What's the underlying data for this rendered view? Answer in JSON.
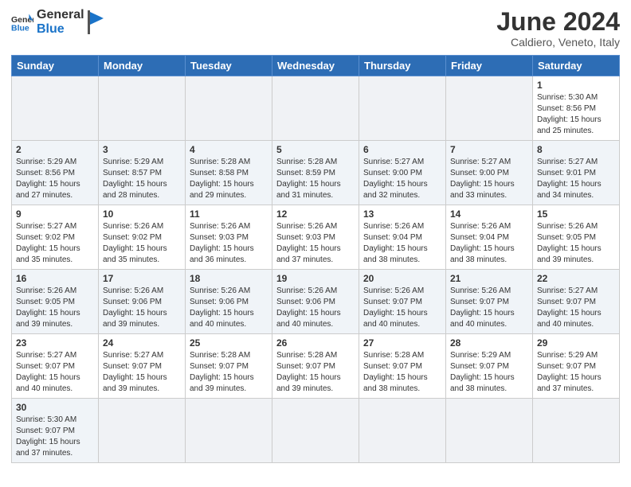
{
  "header": {
    "logo_general": "General",
    "logo_blue": "Blue",
    "title": "June 2024",
    "subtitle": "Caldiero, Veneto, Italy"
  },
  "weekdays": [
    "Sunday",
    "Monday",
    "Tuesday",
    "Wednesday",
    "Thursday",
    "Friday",
    "Saturday"
  ],
  "weeks": [
    [
      {
        "day": "",
        "info": ""
      },
      {
        "day": "",
        "info": ""
      },
      {
        "day": "",
        "info": ""
      },
      {
        "day": "",
        "info": ""
      },
      {
        "day": "",
        "info": ""
      },
      {
        "day": "",
        "info": ""
      },
      {
        "day": "1",
        "info": "Sunrise: 5:30 AM\nSunset: 8:56 PM\nDaylight: 15 hours\nand 25 minutes."
      }
    ],
    [
      {
        "day": "2",
        "info": "Sunrise: 5:29 AM\nSunset: 8:56 PM\nDaylight: 15 hours\nand 27 minutes."
      },
      {
        "day": "3",
        "info": "Sunrise: 5:29 AM\nSunset: 8:57 PM\nDaylight: 15 hours\nand 28 minutes."
      },
      {
        "day": "4",
        "info": "Sunrise: 5:28 AM\nSunset: 8:58 PM\nDaylight: 15 hours\nand 29 minutes."
      },
      {
        "day": "5",
        "info": "Sunrise: 5:28 AM\nSunset: 8:59 PM\nDaylight: 15 hours\nand 31 minutes."
      },
      {
        "day": "6",
        "info": "Sunrise: 5:27 AM\nSunset: 9:00 PM\nDaylight: 15 hours\nand 32 minutes."
      },
      {
        "day": "7",
        "info": "Sunrise: 5:27 AM\nSunset: 9:00 PM\nDaylight: 15 hours\nand 33 minutes."
      },
      {
        "day": "8",
        "info": "Sunrise: 5:27 AM\nSunset: 9:01 PM\nDaylight: 15 hours\nand 34 minutes."
      }
    ],
    [
      {
        "day": "9",
        "info": "Sunrise: 5:27 AM\nSunset: 9:02 PM\nDaylight: 15 hours\nand 35 minutes."
      },
      {
        "day": "10",
        "info": "Sunrise: 5:26 AM\nSunset: 9:02 PM\nDaylight: 15 hours\nand 35 minutes."
      },
      {
        "day": "11",
        "info": "Sunrise: 5:26 AM\nSunset: 9:03 PM\nDaylight: 15 hours\nand 36 minutes."
      },
      {
        "day": "12",
        "info": "Sunrise: 5:26 AM\nSunset: 9:03 PM\nDaylight: 15 hours\nand 37 minutes."
      },
      {
        "day": "13",
        "info": "Sunrise: 5:26 AM\nSunset: 9:04 PM\nDaylight: 15 hours\nand 38 minutes."
      },
      {
        "day": "14",
        "info": "Sunrise: 5:26 AM\nSunset: 9:04 PM\nDaylight: 15 hours\nand 38 minutes."
      },
      {
        "day": "15",
        "info": "Sunrise: 5:26 AM\nSunset: 9:05 PM\nDaylight: 15 hours\nand 39 minutes."
      }
    ],
    [
      {
        "day": "16",
        "info": "Sunrise: 5:26 AM\nSunset: 9:05 PM\nDaylight: 15 hours\nand 39 minutes."
      },
      {
        "day": "17",
        "info": "Sunrise: 5:26 AM\nSunset: 9:06 PM\nDaylight: 15 hours\nand 39 minutes."
      },
      {
        "day": "18",
        "info": "Sunrise: 5:26 AM\nSunset: 9:06 PM\nDaylight: 15 hours\nand 40 minutes."
      },
      {
        "day": "19",
        "info": "Sunrise: 5:26 AM\nSunset: 9:06 PM\nDaylight: 15 hours\nand 40 minutes."
      },
      {
        "day": "20",
        "info": "Sunrise: 5:26 AM\nSunset: 9:07 PM\nDaylight: 15 hours\nand 40 minutes."
      },
      {
        "day": "21",
        "info": "Sunrise: 5:26 AM\nSunset: 9:07 PM\nDaylight: 15 hours\nand 40 minutes."
      },
      {
        "day": "22",
        "info": "Sunrise: 5:27 AM\nSunset: 9:07 PM\nDaylight: 15 hours\nand 40 minutes."
      }
    ],
    [
      {
        "day": "23",
        "info": "Sunrise: 5:27 AM\nSunset: 9:07 PM\nDaylight: 15 hours\nand 40 minutes."
      },
      {
        "day": "24",
        "info": "Sunrise: 5:27 AM\nSunset: 9:07 PM\nDaylight: 15 hours\nand 39 minutes."
      },
      {
        "day": "25",
        "info": "Sunrise: 5:28 AM\nSunset: 9:07 PM\nDaylight: 15 hours\nand 39 minutes."
      },
      {
        "day": "26",
        "info": "Sunrise: 5:28 AM\nSunset: 9:07 PM\nDaylight: 15 hours\nand 39 minutes."
      },
      {
        "day": "27",
        "info": "Sunrise: 5:28 AM\nSunset: 9:07 PM\nDaylight: 15 hours\nand 38 minutes."
      },
      {
        "day": "28",
        "info": "Sunrise: 5:29 AM\nSunset: 9:07 PM\nDaylight: 15 hours\nand 38 minutes."
      },
      {
        "day": "29",
        "info": "Sunrise: 5:29 AM\nSunset: 9:07 PM\nDaylight: 15 hours\nand 37 minutes."
      }
    ],
    [
      {
        "day": "30",
        "info": "Sunrise: 5:30 AM\nSunset: 9:07 PM\nDaylight: 15 hours\nand 37 minutes."
      },
      {
        "day": "",
        "info": ""
      },
      {
        "day": "",
        "info": ""
      },
      {
        "day": "",
        "info": ""
      },
      {
        "day": "",
        "info": ""
      },
      {
        "day": "",
        "info": ""
      },
      {
        "day": "",
        "info": ""
      }
    ]
  ]
}
